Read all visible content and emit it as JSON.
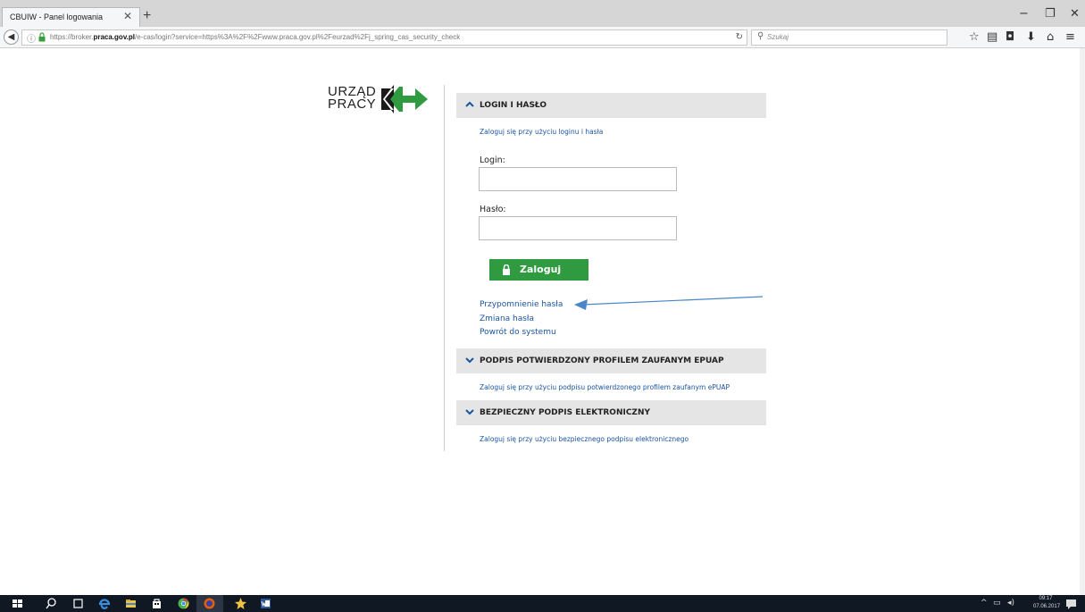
{
  "browser": {
    "tab_title": "CBUIW - Panel logowania",
    "tab_close": "✕",
    "new_tab": "+",
    "url_prefix": "https://broker.",
    "url_domain": "praca.gov.pl",
    "url_suffix": "/e-cas/login?service=https%3A%2F%2Fwww.praca.gov.pl%2Feurzad%2Fj_spring_cas_security_check",
    "search_placeholder": "Szukaj"
  },
  "logo": {
    "line1": "URZĄD",
    "line2": "PRACY"
  },
  "sections": {
    "login": {
      "title": "LOGIN I HASŁO",
      "subtitle": "Zaloguj się przy użyciu loginu i hasła",
      "login_label": "Login:",
      "login_value": "",
      "password_label": "Hasło:",
      "password_value": "",
      "submit_label": "Zaloguj",
      "links": [
        "Przypomnienie hasła",
        "Zmiana hasła",
        "Powrót do systemu"
      ]
    },
    "epuap": {
      "title": "PODPIS POTWIERDZONY PROFILEM ZAUFANYM EPUAP",
      "subtitle": "Zaloguj się przy użyciu podpisu potwierdzonego profilem zaufanym ePUAP"
    },
    "esign": {
      "title": "BEZPIECZNY PODPIS ELEKTRONICZNY",
      "subtitle": "Zaloguj się przy użyciu bezpiecznego podpisu elektronicznego"
    }
  },
  "taskbar": {
    "time": "09:17",
    "date": "07.06.2017"
  },
  "colors": {
    "accent_green": "#2f9a3f",
    "link_blue": "#1a55a0",
    "section_bg": "#e5e5e5",
    "annotation_arrow": "#4a86c8"
  }
}
